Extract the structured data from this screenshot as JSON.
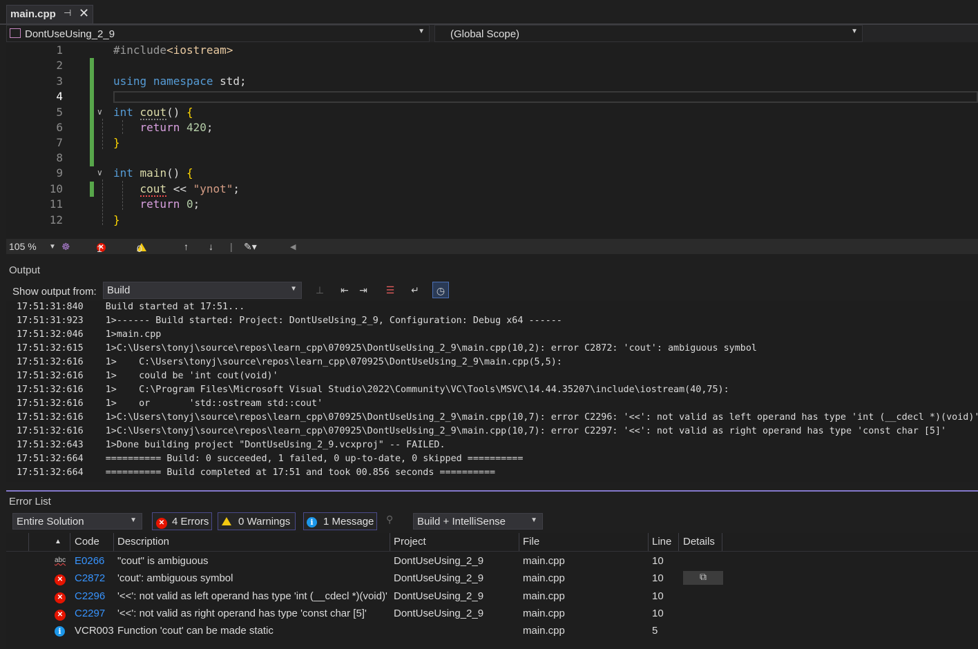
{
  "tab": {
    "name": "main.cpp",
    "pin": "⊣",
    "close": "✕"
  },
  "nav": {
    "project": "DontUseUsing_2_9",
    "scope": "(Global Scope)"
  },
  "editor": {
    "line_numbers": [
      "1",
      "2",
      "3",
      "4",
      "5",
      "6",
      "7",
      "8",
      "9",
      "10",
      "11",
      "12"
    ],
    "lines": {
      "l1_pre": "#include",
      "l1_inc": "<iostream>",
      "l3_kw1": "using",
      "l3_kw2": "namespace",
      "l3_rest": " std;",
      "l5_kw": "int",
      "l5_fn": "cout",
      "l5_par": "()",
      "l5_br": "{",
      "l6_ret": "return",
      "l6_num": "420",
      "l6_semi": ";",
      "l7_br": "}",
      "l9_kw": "int",
      "l9_fn": "main",
      "l9_par": "()",
      "l9_br": "{",
      "l10_id": "cout",
      "l10_op": " << ",
      "l10_str": "\"ynot\"",
      "l10_semi": ";",
      "l11_ret": "return",
      "l11_num": "0",
      "l11_semi": ";",
      "l12_br": "}"
    }
  },
  "editor_status": {
    "zoom": "105 %",
    "errors": "1",
    "warnings": "0"
  },
  "output": {
    "title": "Output",
    "show_from_label": "Show output from:",
    "source": "Build",
    "lines": [
      {
        "time": "17:51:31:840",
        "text": "Build started at 17:51..."
      },
      {
        "time": "17:51:31:923",
        "text": "1>------ Build started: Project: DontUseUsing_2_9, Configuration: Debug x64 ------"
      },
      {
        "time": "17:51:32:046",
        "text": "1>main.cpp"
      },
      {
        "time": "17:51:32:615",
        "text": "1>C:\\Users\\tonyj\\source\\repos\\learn_cpp\\070925\\DontUseUsing_2_9\\main.cpp(10,2): error C2872: 'cout': ambiguous symbol"
      },
      {
        "time": "17:51:32:616",
        "text": "1>    C:\\Users\\tonyj\\source\\repos\\learn_cpp\\070925\\DontUseUsing_2_9\\main.cpp(5,5):"
      },
      {
        "time": "17:51:32:616",
        "text": "1>    could be 'int cout(void)'"
      },
      {
        "time": "17:51:32:616",
        "text": "1>    C:\\Program Files\\Microsoft Visual Studio\\2022\\Community\\VC\\Tools\\MSVC\\14.44.35207\\include\\iostream(40,75):"
      },
      {
        "time": "17:51:32:616",
        "text": "1>    or       'std::ostream std::cout'"
      },
      {
        "time": "17:51:32:616",
        "text": "1>C:\\Users\\tonyj\\source\\repos\\learn_cpp\\070925\\DontUseUsing_2_9\\main.cpp(10,7): error C2296: '<<': not valid as left operand has type 'int (__cdecl *)(void)'"
      },
      {
        "time": "17:51:32:616",
        "text": "1>C:\\Users\\tonyj\\source\\repos\\learn_cpp\\070925\\DontUseUsing_2_9\\main.cpp(10,7): error C2297: '<<': not valid as right operand has type 'const char [5]'"
      },
      {
        "time": "17:51:32:643",
        "text": "1>Done building project \"DontUseUsing_2_9.vcxproj\" -- FAILED."
      },
      {
        "time": "17:51:32:664",
        "text": "========== Build: 0 succeeded, 1 failed, 0 up-to-date, 0 skipped =========="
      },
      {
        "time": "17:51:32:664",
        "text": "========== Build completed at 17:51 and took 00.856 seconds =========="
      }
    ]
  },
  "error_list": {
    "title": "Error List",
    "scope": "Entire Solution",
    "errors_btn": "4 Errors",
    "warnings_btn": "0 Warnings",
    "messages_btn": "1 Message",
    "source": "Build + IntelliSense",
    "columns": {
      "code": "Code",
      "description": "Description",
      "project": "Project",
      "file": "File",
      "line": "Line",
      "details": "Details"
    },
    "rows": [
      {
        "icon": "abc-spell-icon",
        "code": "E0266",
        "description": "\"cout\" is ambiguous",
        "project": "DontUseUsing_2_9",
        "file": "main.cpp",
        "line": "10"
      },
      {
        "icon": "error-icon",
        "code": "C2872",
        "description": "'cout': ambiguous symbol",
        "project": "DontUseUsing_2_9",
        "file": "main.cpp",
        "line": "10"
      },
      {
        "icon": "error-icon",
        "code": "C2296",
        "description": "'<<': not valid as left operand has type 'int (__cdecl *)(void)'",
        "project": "DontUseUsing_2_9",
        "file": "main.cpp",
        "line": "10"
      },
      {
        "icon": "error-icon",
        "code": "C2297",
        "description": "'<<': not valid as right operand has type 'const char [5]'",
        "project": "DontUseUsing_2_9",
        "file": "main.cpp",
        "line": "10"
      },
      {
        "icon": "info-icon",
        "code": "VCR003",
        "description": "Function 'cout' can be made static",
        "project": "",
        "file": "main.cpp",
        "line": "5"
      }
    ]
  },
  "colors": {
    "error": "#e51400",
    "warning": "#f2c811",
    "info": "#1c97ea",
    "accent": "#8478cc",
    "gutter_change": "#57a64a"
  }
}
